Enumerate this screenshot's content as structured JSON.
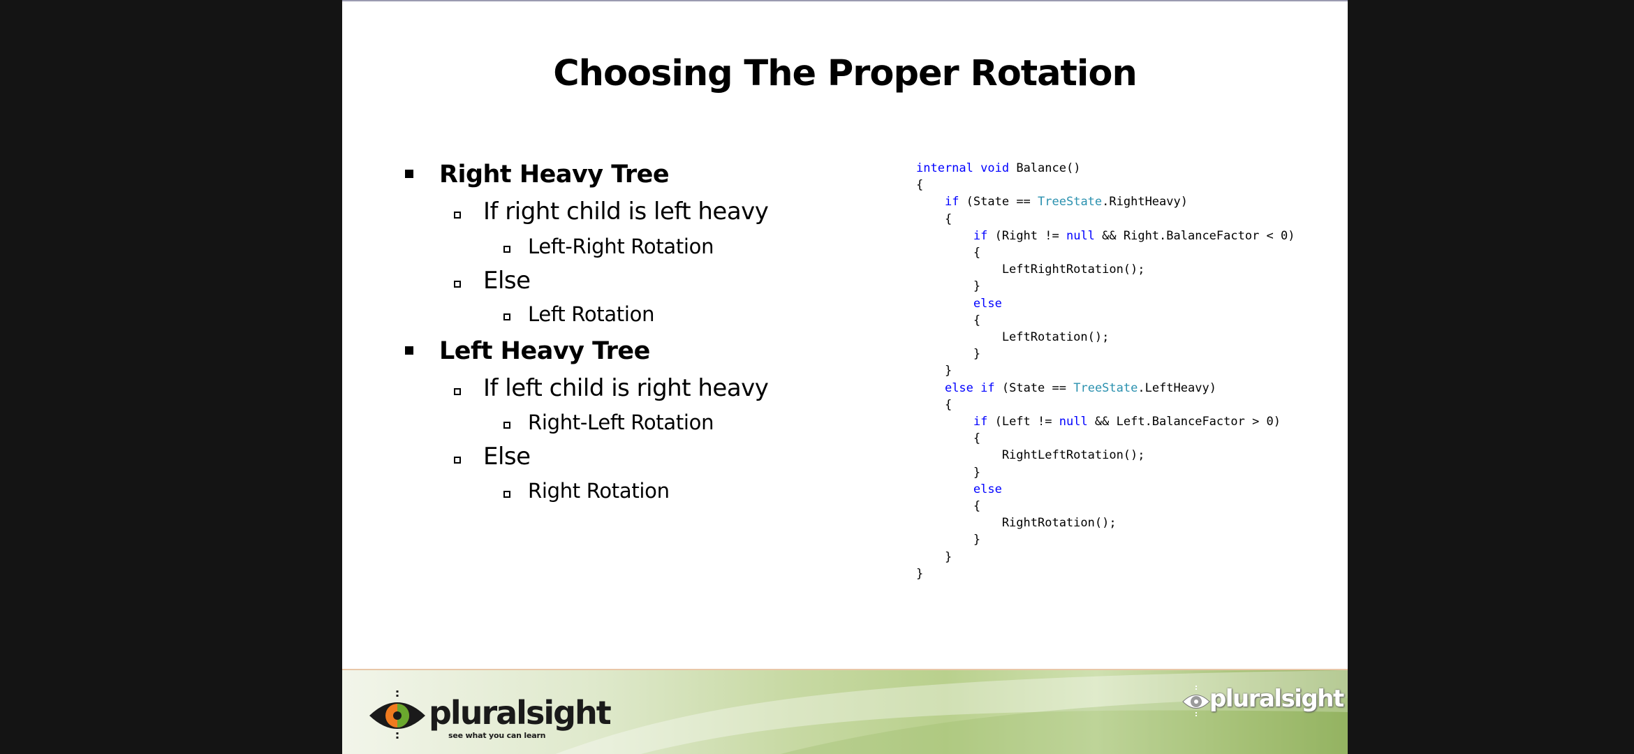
{
  "slide": {
    "title": "Choosing The Proper Rotation",
    "bullets": [
      {
        "level": 1,
        "text": "Right Heavy Tree"
      },
      {
        "level": 2,
        "text": "If right child is left heavy"
      },
      {
        "level": 3,
        "text": "Left-Right Rotation"
      },
      {
        "level": 2,
        "text": "Else"
      },
      {
        "level": 3,
        "text": "Left Rotation"
      },
      {
        "level": 1,
        "text": "Left Heavy Tree"
      },
      {
        "level": 2,
        "text": "If left child is right heavy"
      },
      {
        "level": 3,
        "text": "Right-Left Rotation"
      },
      {
        "level": 2,
        "text": "Else"
      },
      {
        "level": 3,
        "text": "Right Rotation"
      }
    ],
    "code_lines": [
      [
        {
          "t": "kw",
          "v": "internal"
        },
        {
          "t": "",
          "v": " "
        },
        {
          "t": "kw",
          "v": "void"
        },
        {
          "t": "",
          "v": " Balance()"
        }
      ],
      [
        {
          "t": "",
          "v": "{"
        }
      ],
      [
        {
          "t": "",
          "v": "    "
        },
        {
          "t": "kw",
          "v": "if"
        },
        {
          "t": "",
          "v": " (State == "
        },
        {
          "t": "ty",
          "v": "TreeState"
        },
        {
          "t": "",
          "v": ".RightHeavy)"
        }
      ],
      [
        {
          "t": "",
          "v": "    {"
        }
      ],
      [
        {
          "t": "",
          "v": "        "
        },
        {
          "t": "kw",
          "v": "if"
        },
        {
          "t": "",
          "v": " (Right != "
        },
        {
          "t": "kw",
          "v": "null"
        },
        {
          "t": "",
          "v": " && Right.BalanceFactor < 0)"
        }
      ],
      [
        {
          "t": "",
          "v": "        {"
        }
      ],
      [
        {
          "t": "",
          "v": "            LeftRightRotation();"
        }
      ],
      [
        {
          "t": "",
          "v": "        }"
        }
      ],
      [
        {
          "t": "",
          "v": "        "
        },
        {
          "t": "kw",
          "v": "else"
        }
      ],
      [
        {
          "t": "",
          "v": "        {"
        }
      ],
      [
        {
          "t": "",
          "v": "            LeftRotation();"
        }
      ],
      [
        {
          "t": "",
          "v": "        }"
        }
      ],
      [
        {
          "t": "",
          "v": "    }"
        }
      ],
      [
        {
          "t": "",
          "v": "    "
        },
        {
          "t": "kw",
          "v": "else"
        },
        {
          "t": "",
          "v": " "
        },
        {
          "t": "kw",
          "v": "if"
        },
        {
          "t": "",
          "v": " (State == "
        },
        {
          "t": "ty",
          "v": "TreeState"
        },
        {
          "t": "",
          "v": ".LeftHeavy)"
        }
      ],
      [
        {
          "t": "",
          "v": "    {"
        }
      ],
      [
        {
          "t": "",
          "v": "        "
        },
        {
          "t": "kw",
          "v": "if"
        },
        {
          "t": "",
          "v": " (Left != "
        },
        {
          "t": "kw",
          "v": "null"
        },
        {
          "t": "",
          "v": " && Left.BalanceFactor > 0)"
        }
      ],
      [
        {
          "t": "",
          "v": "        {"
        }
      ],
      [
        {
          "t": "",
          "v": "            RightLeftRotation();"
        }
      ],
      [
        {
          "t": "",
          "v": "        }"
        }
      ],
      [
        {
          "t": "",
          "v": "        "
        },
        {
          "t": "kw",
          "v": "else"
        }
      ],
      [
        {
          "t": "",
          "v": "        {"
        }
      ],
      [
        {
          "t": "",
          "v": "            RightRotation();"
        }
      ],
      [
        {
          "t": "",
          "v": "        }"
        }
      ],
      [
        {
          "t": "",
          "v": "    }"
        }
      ],
      [
        {
          "t": "",
          "v": "}"
        }
      ]
    ]
  },
  "footer": {
    "brand": "pluralsight",
    "tagline": "see what you can learn",
    "brand_small": "pluralsight"
  },
  "colors": {
    "keyword": "#0000ff",
    "type": "#2b91af",
    "logo_orange": "#f07b1f",
    "logo_green": "#6aa82e"
  },
  "icons": {
    "logo": "pluralsight-eye-logo",
    "bullet_level1": "filled-square",
    "bullet_level2": "hollow-square",
    "bullet_level3": "hollow-square"
  }
}
